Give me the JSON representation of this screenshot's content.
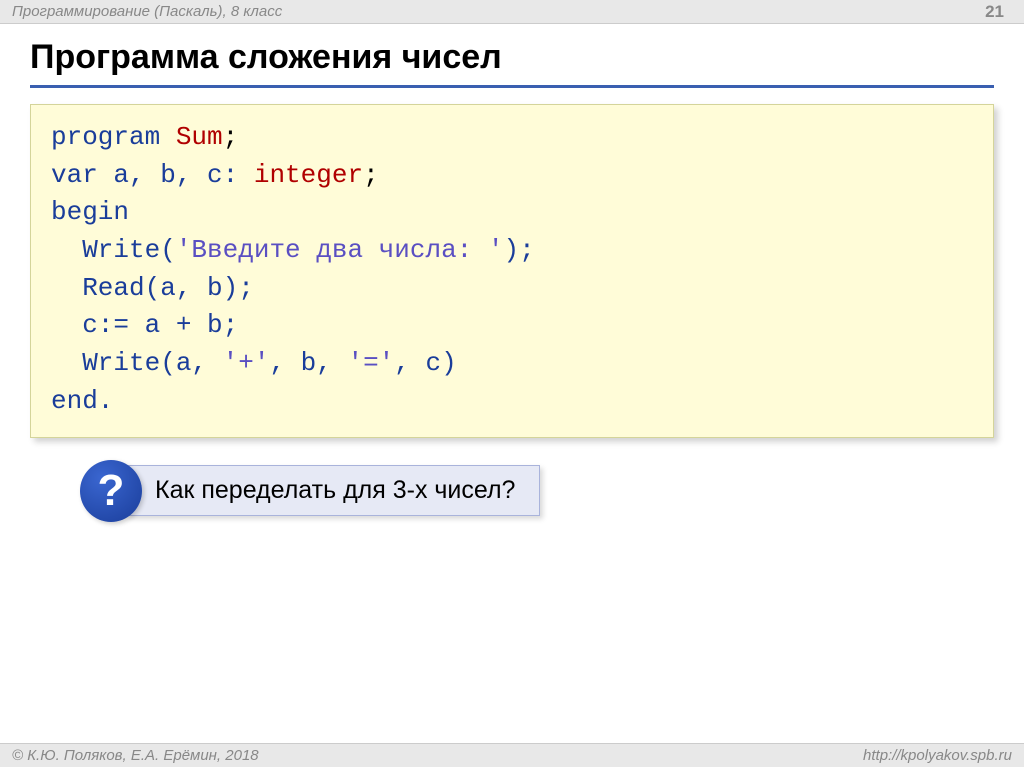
{
  "header": {
    "left": "Программирование (Паскаль), 8 класс",
    "page": "21"
  },
  "title": "Программа сложения чисел",
  "code": {
    "l1a": "program ",
    "l1b": "Sum",
    "l1c": ";",
    "l2a": "var a, b, c: ",
    "l2b": "integer",
    "l2c": ";",
    "l3": "begin",
    "l4a": "  Write(",
    "l4b": "'Введите два числа: '",
    "l4c": ");",
    "l5": "  Read(a, b);",
    "l6": "  c:= a + b;",
    "l7a": "  Write(a, ",
    "l7b": "'+'",
    "l7c": ", b, ",
    "l7d": "'='",
    "l7e": ", c)",
    "l8": "end."
  },
  "question": {
    "mark": "?",
    "text": "Как переделать для 3-х чисел?"
  },
  "footer": {
    "left": "© К.Ю. Поляков, Е.А. Ерёмин, 2018",
    "right": "http://kpolyakov.spb.ru"
  }
}
